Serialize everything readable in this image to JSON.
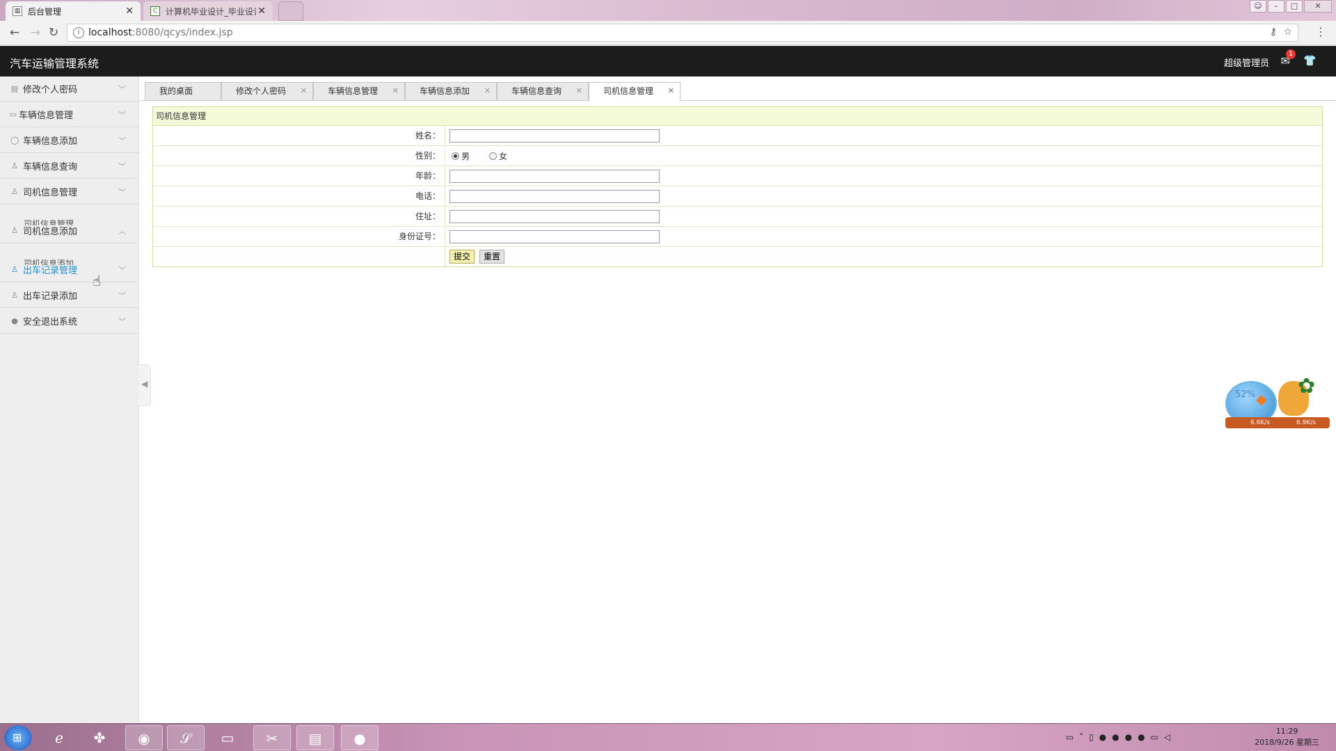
{
  "browser": {
    "tabs": [
      {
        "label": "后台管理",
        "active": true
      },
      {
        "label": "计算机毕业设计_毕业设计",
        "active": false
      }
    ],
    "url_host": "localhost",
    "url_path": ":8080/qcys/index.jsp"
  },
  "header": {
    "title": "汽车运输管理系统",
    "user": "超级管理员",
    "mail_badge": "1"
  },
  "sidebar": {
    "items": [
      {
        "label": "修改个人密码",
        "icon": "document-icon"
      },
      {
        "label": "车辆信息管理",
        "icon": "card-icon"
      },
      {
        "label": "车辆信息添加",
        "icon": "chat-icon"
      },
      {
        "label": "车辆信息查询",
        "icon": "person-icon"
      },
      {
        "label": "司机信息管理",
        "icon": "person-icon"
      },
      {
        "label": "司机信息添加",
        "icon": "person-icon"
      },
      {
        "label": "出车记录管理",
        "icon": "person-icon"
      },
      {
        "label": "出车记录添加",
        "icon": "person-icon"
      },
      {
        "label": "安全退出系统",
        "icon": "user-icon"
      }
    ],
    "sub_driver_manage": "司机信息管理",
    "sub_driver_add": "司机信息添加"
  },
  "content_tabs": [
    {
      "label": "我的桌面"
    },
    {
      "label": "修改个人密码"
    },
    {
      "label": "车辆信息管理"
    },
    {
      "label": "车辆信息添加"
    },
    {
      "label": "车辆信息查询"
    },
    {
      "label": "司机信息管理"
    }
  ],
  "form": {
    "title": "司机信息管理",
    "name_label": "姓名：",
    "gender_label": "性别：",
    "gender_male": "男",
    "gender_female": "女",
    "gender_selected": "男",
    "age_label": "年龄：",
    "phone_label": "电话：",
    "address_label": "住址：",
    "id_label": "身份证号：",
    "submit_label": "提交",
    "reset_label": "重置"
  },
  "widget": {
    "percent": "52%",
    "up_speed": "6.6K/s",
    "down_speed": "6.9K/s"
  },
  "taskbar": {
    "time": "11:29",
    "date": "2018/9/26 星期三"
  }
}
